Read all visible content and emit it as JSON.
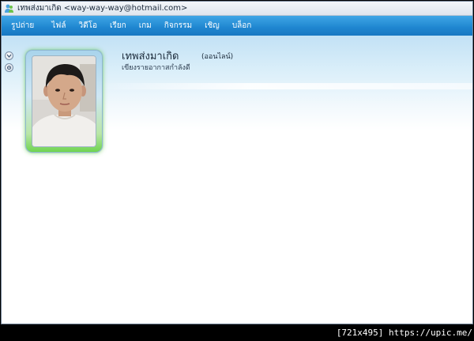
{
  "window": {
    "title_name": "เทพส่งมาเกิด",
    "title_email": "<way-way-way@hotmail.com>"
  },
  "menu": {
    "items": [
      "รูปถ่าย",
      "ไฟล์",
      "วิดีโอ",
      "เรียก",
      "เกม",
      "กิจกรรม",
      "เชิญ",
      "บล็อก"
    ]
  },
  "contact": {
    "name": "เทพส่งมาเกิด",
    "status": "(ออนไลน์)",
    "personal_message": "เขียงรายอากาสกำลังดี"
  },
  "watermark": "[721x495] https://upic.me/",
  "colors": {
    "menubar": "#1f86d0",
    "avatar_glow": "#6fd450",
    "background": "#000000"
  }
}
